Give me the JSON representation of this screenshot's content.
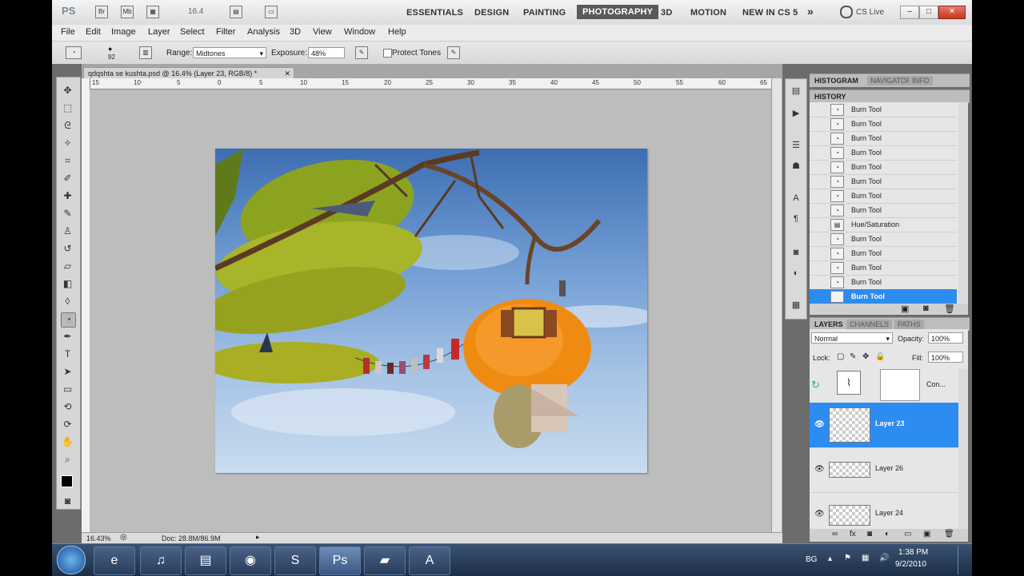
{
  "app": {
    "logo": "PS",
    "zoom_display": "16.4",
    "workspaces": [
      "ESSENTIALS",
      "DESIGN",
      "PAINTING",
      "PHOTOGRAPHY",
      "3D",
      "MOTION",
      "NEW IN CS 5"
    ],
    "active_workspace": "PHOTOGRAPHY",
    "more_glyph": "»",
    "cs_live": "CS Live",
    "win_buttons": {
      "minimize": "–",
      "maximize": "□",
      "close": "✕"
    }
  },
  "menubar": [
    "File",
    "Edit",
    "Image",
    "Layer",
    "Select",
    "Filter",
    "Analysis",
    "3D",
    "View",
    "Window",
    "Help"
  ],
  "options": {
    "brush_size": "92",
    "range_label": "Range:",
    "range_value": "Midtones",
    "exposure_label": "Exposure:",
    "exposure_value": "48%",
    "protect_tones": "Protect Tones"
  },
  "document": {
    "tab_title": "qdqshta se kushta.psd @ 16.4% (Layer 23, RGB/8) *",
    "ruler_ticks": [
      "15",
      "10",
      "5",
      "0",
      "5",
      "10",
      "15",
      "20",
      "25",
      "30",
      "35",
      "40",
      "45",
      "50",
      "55",
      "60",
      "65"
    ],
    "zoom_status": "16.43%",
    "doc_info": "Doc: 28.8M/86.9M"
  },
  "panels": {
    "top_tabs": [
      "HISTOGRAM",
      "NAVIGATOR",
      "INFO"
    ],
    "history_title": "HISTORY",
    "history_items": [
      "Burn Tool",
      "Burn Tool",
      "Burn Tool",
      "Burn Tool",
      "Burn Tool",
      "Burn Tool",
      "Burn Tool",
      "Burn Tool",
      "Hue/Saturation",
      "Burn Tool",
      "Burn Tool",
      "Burn Tool",
      "Burn Tool",
      "Burn Tool"
    ],
    "history_selected_index": 13,
    "layer_tabs": [
      "LAYERS",
      "CHANNELS",
      "PATHS"
    ],
    "blend_mode": "Normal",
    "opacity_label": "Opacity:",
    "opacity_value": "100%",
    "lock_label": "Lock:",
    "fill_label": "Fill:",
    "fill_value": "100%",
    "layers": [
      {
        "name": "Con...",
        "type": "adjustment"
      },
      {
        "name": "Layer 23",
        "selected": true
      },
      {
        "name": "Layer 26"
      },
      {
        "name": "Layer 24"
      }
    ]
  },
  "taskbar": {
    "lang": "BG",
    "time": "1:38 PM",
    "date": "9/2/2010",
    "buttons": [
      "ie-icon",
      "itunes-icon",
      "explorer-icon",
      "picasa-icon",
      "skype-icon",
      "photoshop-icon",
      "notes-icon",
      "acrobat-icon"
    ]
  },
  "colors": {
    "selection": "#2d8cf0",
    "panel_bg": "#e6e6e6",
    "dark_frame": "#6c6c6c"
  }
}
